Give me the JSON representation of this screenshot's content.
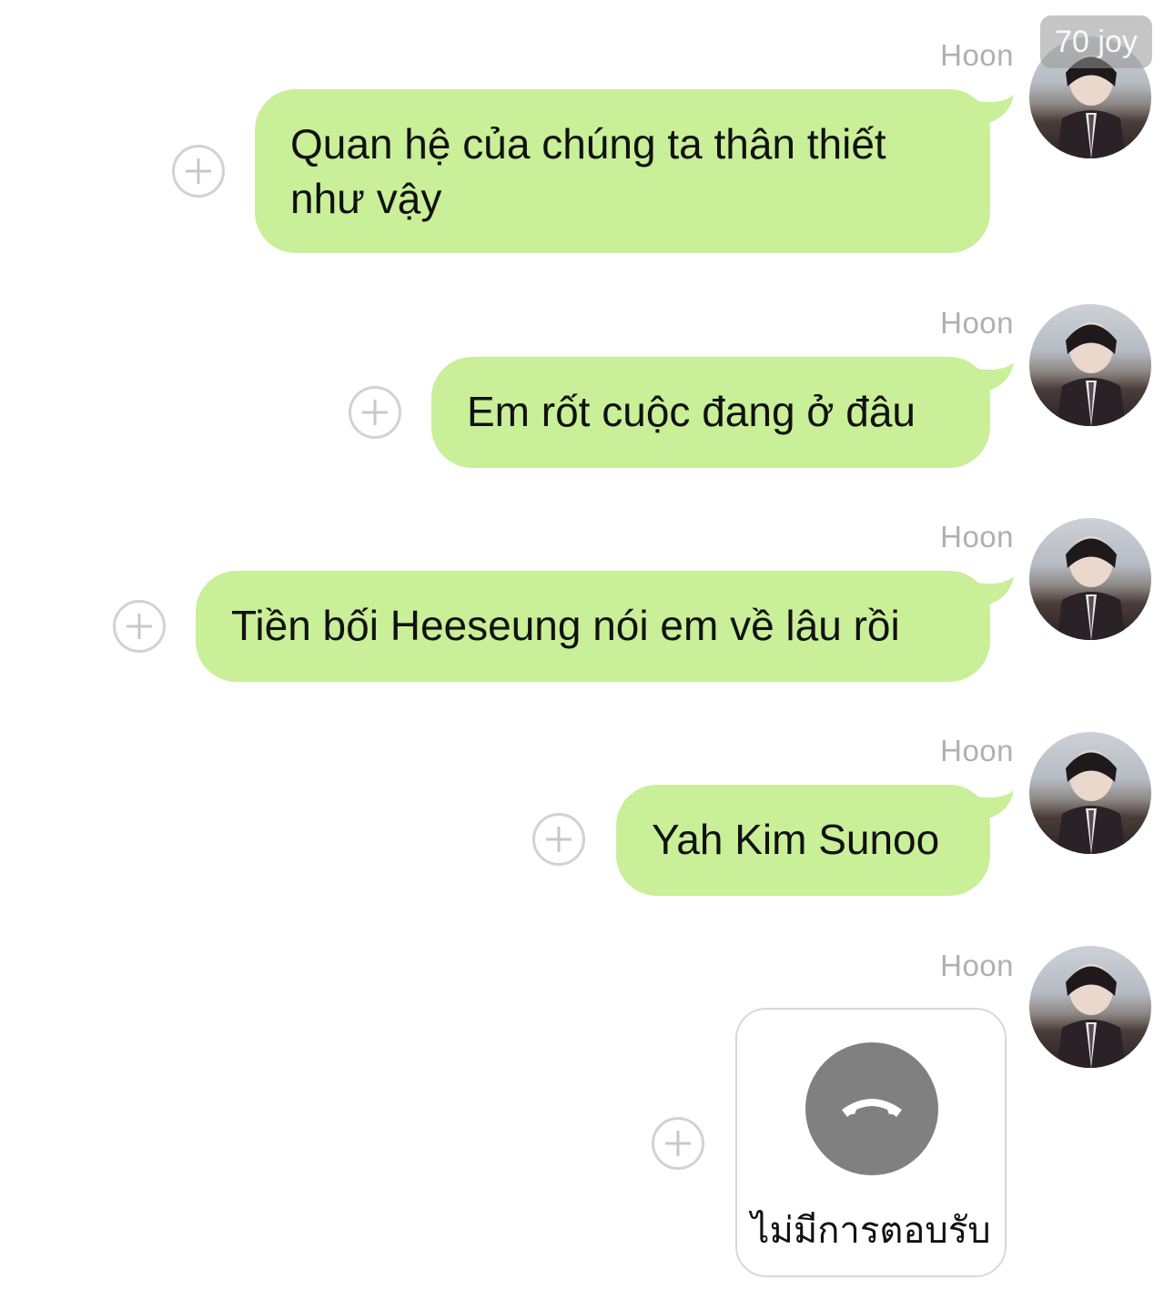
{
  "watermark": "70 joy",
  "messages": [
    {
      "sender": "Hoon",
      "text": "Quan hệ của chúng ta thân thiết như vậy"
    },
    {
      "sender": "Hoon",
      "text": "Em rốt cuộc đang ở đâu"
    },
    {
      "sender": "Hoon",
      "text": "Tiền bối Heeseung nói em về lâu rồi"
    },
    {
      "sender": "Hoon",
      "text": "Yah Kim Sunoo"
    },
    {
      "sender": "Hoon",
      "call": {
        "icon": "phone-hangup-icon",
        "status": "ไม่มีการตอบรับ"
      }
    }
  ],
  "colors": {
    "bubble": "#c9ef98",
    "sender_name": "#b0b0b0",
    "call_icon_bg": "#808080"
  }
}
